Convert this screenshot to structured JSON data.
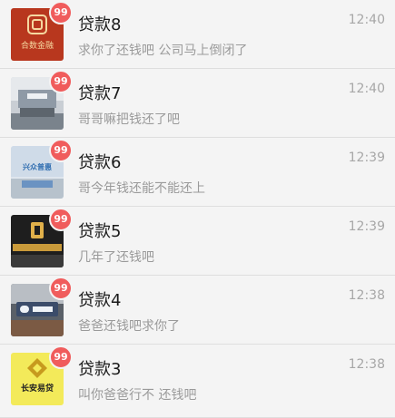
{
  "chats": [
    {
      "name": "贷款8",
      "message": "求你了还钱吧 公司马上倒闭了",
      "time": "12:40",
      "badge": "99",
      "logo_text": "合数金融",
      "avatar_style": "red-logo",
      "avatar_color": "#b8371e"
    },
    {
      "name": "贷款7",
      "message": "哥哥嘛把钱还了吧",
      "time": "12:40",
      "badge": "99",
      "avatar_style": "office-wall",
      "avatar_color": "#8f9aa6"
    },
    {
      "name": "贷款6",
      "message": "哥今年钱还能不能还上",
      "time": "12:39",
      "badge": "99",
      "logo_text": "兴众普惠",
      "avatar_style": "blue-lobby",
      "avatar_color": "#6b93c2"
    },
    {
      "name": "贷款5",
      "message": "几年了还钱吧",
      "time": "12:39",
      "badge": "99",
      "avatar_style": "dark-sign",
      "avatar_color": "#2a2a2a"
    },
    {
      "name": "贷款4",
      "message": "爸爸还钱吧求你了",
      "time": "12:38",
      "badge": "99",
      "avatar_style": "blue-sign",
      "avatar_color": "#3b4c6a"
    },
    {
      "name": "贷款3",
      "message": "叫你爸爸行不  还钱吧",
      "time": "12:38",
      "badge": "99",
      "logo_text": "长安易贷",
      "avatar_style": "yellow-logo",
      "avatar_color": "#f3ea5a"
    }
  ]
}
